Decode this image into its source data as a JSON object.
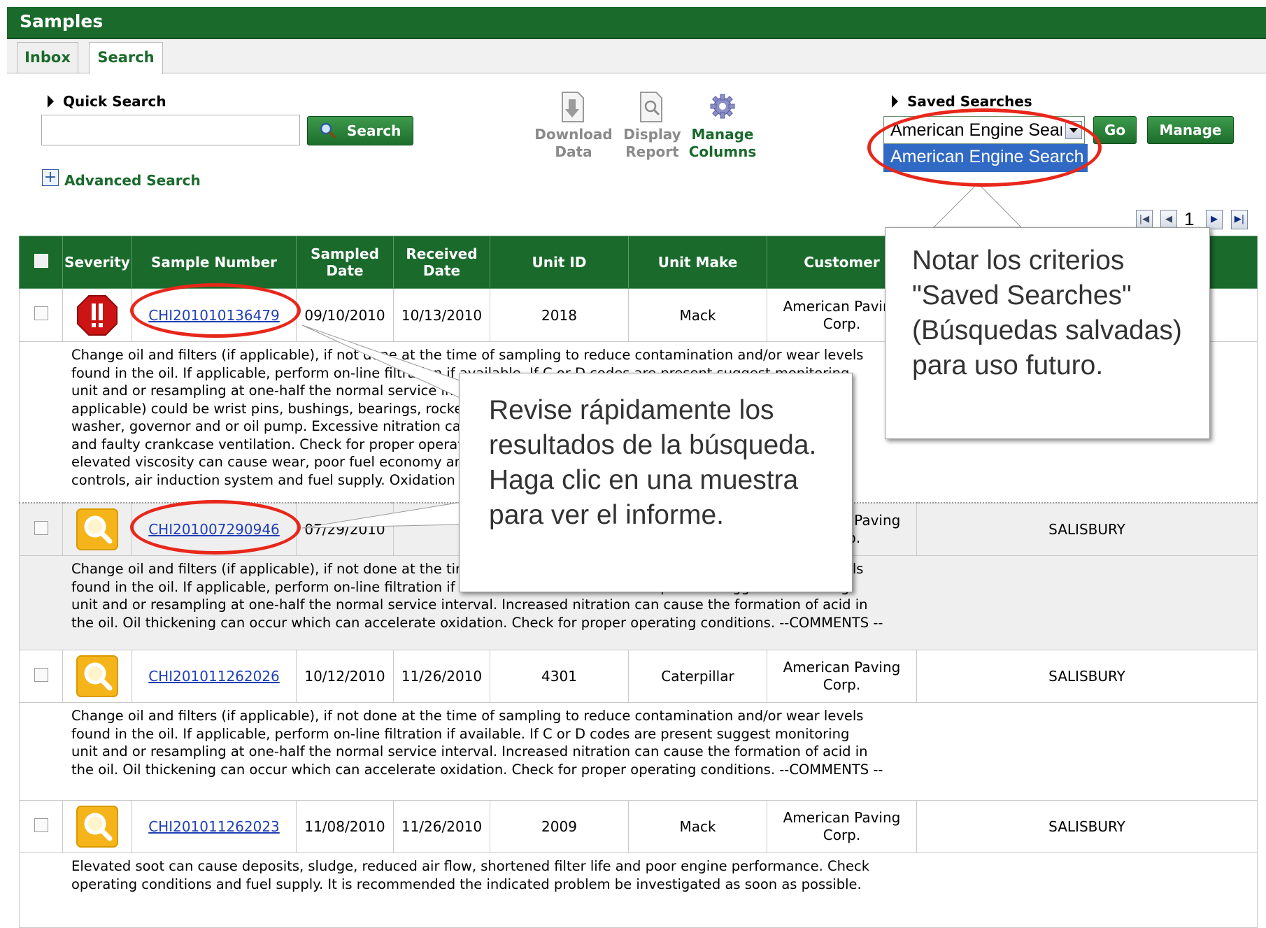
{
  "header": {
    "title": "Samples"
  },
  "tabs": [
    {
      "label": "Inbox"
    },
    {
      "label": "Search"
    }
  ],
  "quick_search": {
    "label": "Quick Search",
    "value": "",
    "button": "Search"
  },
  "advanced_search": {
    "label": "Advanced Search"
  },
  "tools": {
    "download": {
      "line1": "Download",
      "line2": "Data"
    },
    "display": {
      "line1": "Display",
      "line2": "Report"
    },
    "manage_columns": {
      "line1": "Manage",
      "line2": "Columns"
    }
  },
  "saved_searches": {
    "label": "Saved Searches",
    "selected": "American Engine Search",
    "option": "American Engine Search",
    "go": "Go",
    "manage": "Manage"
  },
  "pagination": {
    "page": "1"
  },
  "table": {
    "headers": {
      "severity": "Severity",
      "sample_number": "Sample Number",
      "sampled_line1": "Sampled",
      "sampled_line2": "Date",
      "received_line1": "Received",
      "received_line2": "Date",
      "unit_id": "Unit ID",
      "unit_make": "Unit Make",
      "customer": "Customer"
    },
    "rows": [
      {
        "sample_number": "CHI201010136479",
        "sampled": "09/10/2010",
        "received": "10/13/2010",
        "unit_id": "2018",
        "unit_make": "Mack",
        "customer_line1": "American Paving",
        "customer_line2": "Corp.",
        "location": "",
        "comment": [
          "Change oil and filters (if applicable), if not done at the time of sampling to reduce contamination and/or wear levels",
          "found in the oil. If applicable, perform on-line filtration if available. If C or D codes are present suggest monitoring",
          "unit and or resampling at one-half the normal service interval. Possible sources of wear metals",
          "applicable) could be wrist pins, bushings, bearings, rocker arm bushings, rod bushings,",
          "washer, governor and or oil pump. Excessive nitration can be caused by excessive",
          "and faulty crankcase ventilation. Check for proper operating conditions. Elevated soot and",
          "elevated viscosity can cause wear, poor fuel economy and deposits. Check the emission",
          "controls, air induction system and fuel supply. Oxidation can occur. --COMMENTS --"
        ]
      },
      {
        "sample_number": "CHI201007290946",
        "sampled": "07/29/2010",
        "received": "",
        "unit_id": "",
        "unit_make": "",
        "customer_line1": "American Paving",
        "customer_line2": "Corp.",
        "location": "SALISBURY",
        "comment": [
          "Change oil and filters (if applicable), if not done at the time of sampling to reduce contamination and/or wear levels",
          "found in the oil. If applicable, perform on-line filtration if available. If C or D codes are present suggest monitoring",
          "unit and or resampling at one-half the normal service interval. Increased nitration can cause the formation of acid in",
          "the oil. Oil thickening can occur which can accelerate oxidation. Check for proper operating conditions. --COMMENTS --"
        ]
      },
      {
        "sample_number": "CHI201011262026",
        "sampled": "10/12/2010",
        "received": "11/26/2010",
        "unit_id": "4301",
        "unit_make": "Caterpillar",
        "customer_line1": "American Paving",
        "customer_line2": "Corp.",
        "location": "SALISBURY",
        "comment": [
          "Change oil and filters (if applicable), if not done at the time of sampling to reduce contamination and/or wear levels",
          "found in the oil. If applicable, perform on-line filtration if available. If C or D codes are present suggest monitoring",
          "unit and or resampling at one-half the normal service interval. Increased nitration can cause the formation of acid in",
          "the oil. Oil thickening can occur which can accelerate oxidation. Check for proper operating conditions. --COMMENTS --"
        ]
      },
      {
        "sample_number": "CHI201011262023",
        "sampled": "11/08/2010",
        "received": "11/26/2010",
        "unit_id": "2009",
        "unit_make": "Mack",
        "customer_line1": "American Paving",
        "customer_line2": "Corp.",
        "location": "SALISBURY",
        "comment": [
          "Elevated soot can cause deposits, sludge, reduced air flow, shortened filter life and poor engine performance. Check",
          "operating conditions and fuel supply. It is recommended the indicated problem be investigated as soon as possible."
        ]
      }
    ]
  },
  "callouts": {
    "saved": "Notar los criterios \"Saved Searches\" (Búsquedas salvadas) para uso futuro.",
    "review": "Revise rápidamente los resultados de la búsqueda. Haga clic en una muestra para ver el informe."
  },
  "colors": {
    "header_green": "#1a6a2c",
    "link_blue": "#1f3fb5",
    "highlight_red": "#e8271b",
    "option_blue": "#316ac5"
  }
}
